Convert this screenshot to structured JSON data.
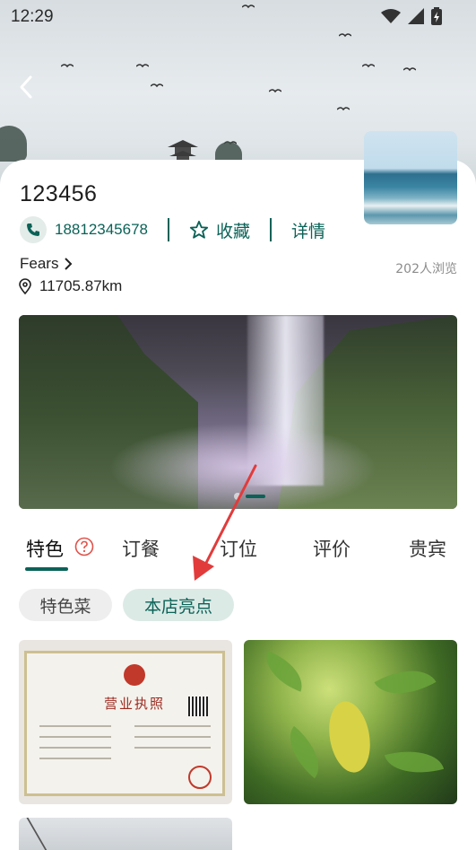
{
  "status_bar": {
    "time": "12:29"
  },
  "shop": {
    "name": "123456",
    "phone": "18812345678",
    "favorite_label": "收藏",
    "detail_label": "详情",
    "owner": "Fears",
    "distance": "11705.87km",
    "views": "202人浏览"
  },
  "tabs": [
    {
      "label": "特色"
    },
    {
      "label": "订餐"
    },
    {
      "label": "订位"
    },
    {
      "label": "评价"
    },
    {
      "label": "贵宾"
    }
  ],
  "chips": [
    {
      "label": "特色菜"
    },
    {
      "label": "本店亮点"
    }
  ],
  "license": {
    "title": "营业执照"
  },
  "colors": {
    "accent": "#0b6257",
    "annotation": "#e23b3b"
  }
}
